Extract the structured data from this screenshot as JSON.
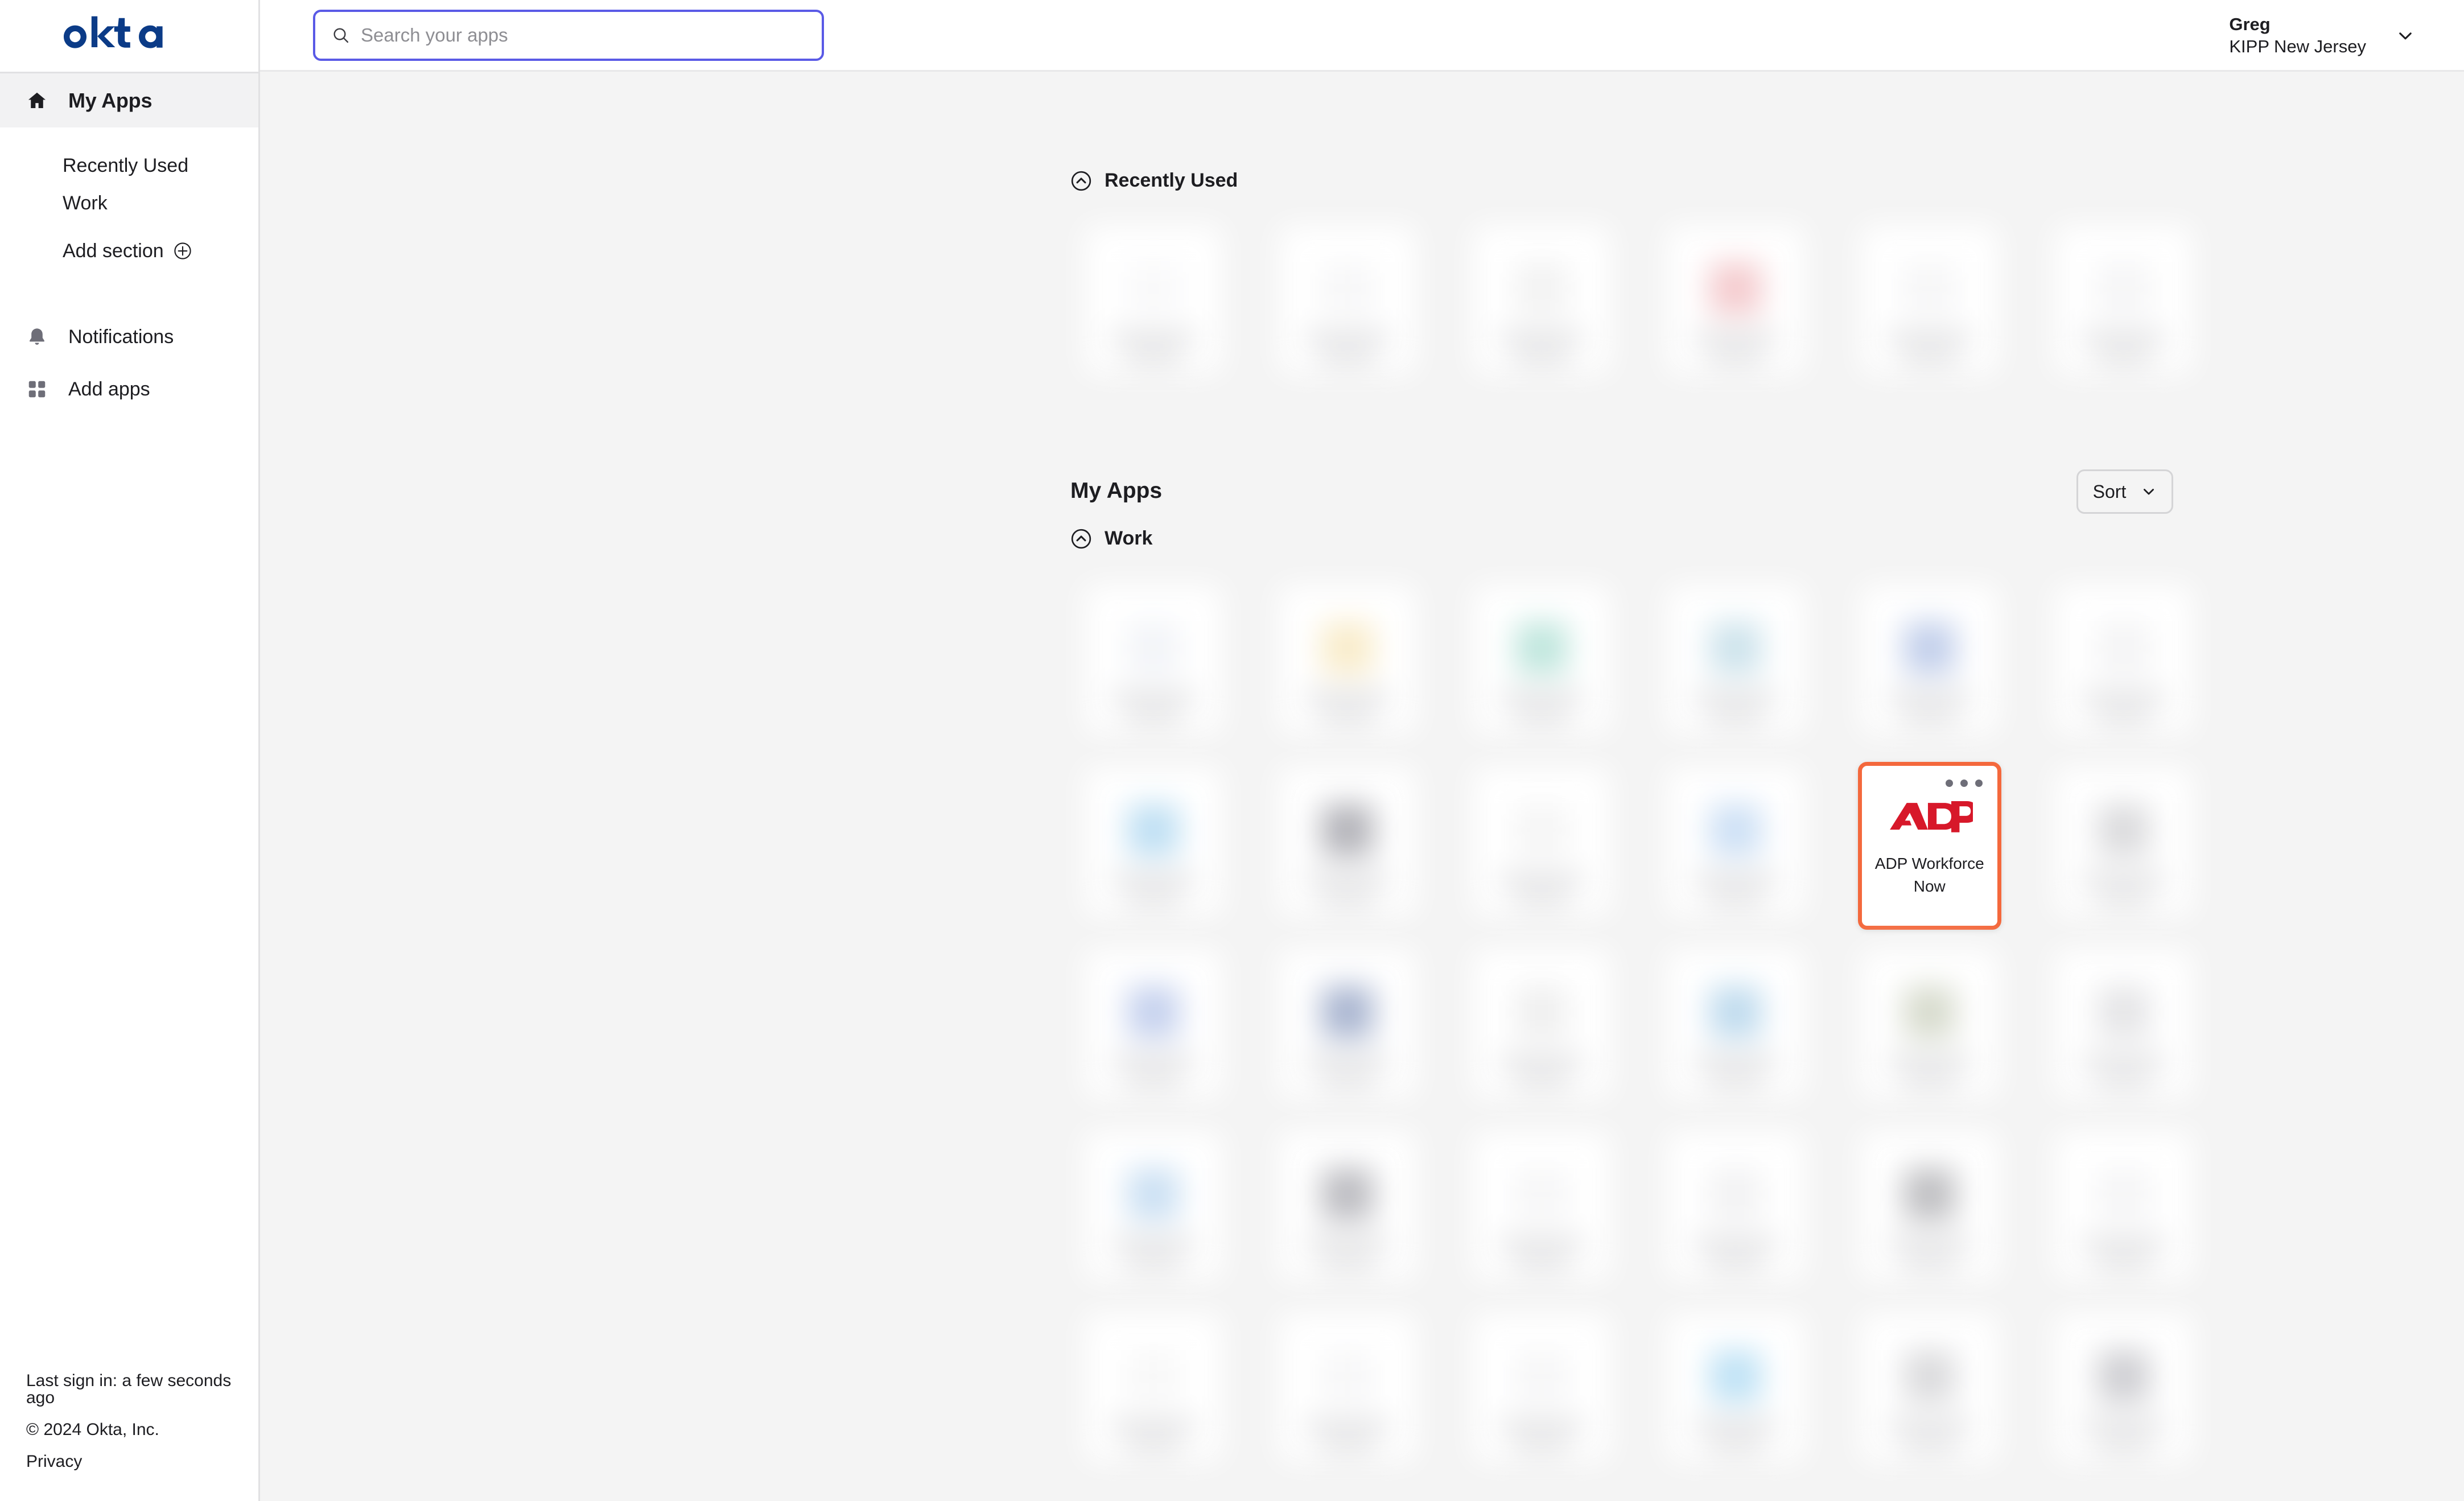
{
  "brand": {
    "logo_text": "okta",
    "logo_color": "#0b3b87",
    "accent_focus": "#f4683c",
    "search_focus_border": "#5a5ae6",
    "adp_red": "#d7182a"
  },
  "sidebar": {
    "primary": {
      "label": "My Apps",
      "icon": "home-icon",
      "active": true
    },
    "sub_items": [
      {
        "label": "Recently Used",
        "icon": null
      },
      {
        "label": "Work",
        "icon": null
      },
      {
        "label": "Add section",
        "icon": "plus-circle-icon"
      }
    ],
    "lower_items": [
      {
        "label": "Notifications",
        "icon": "bell-icon"
      },
      {
        "label": "Add apps",
        "icon": "grid-apps-icon"
      }
    ],
    "footer": {
      "last_sign_in": "Last sign in: a few seconds ago",
      "copyright": "© 2024 Okta, Inc.",
      "privacy": "Privacy"
    }
  },
  "topbar": {
    "search": {
      "placeholder": "Search your apps",
      "value": "",
      "icon": "search-icon",
      "focused": true
    },
    "user": {
      "name": "Greg",
      "org": "KIPP New Jersey",
      "chevron": "chevron-down-icon"
    }
  },
  "main": {
    "recently_used": {
      "label": "Recently Used",
      "collapse_icon": "chevron-up-circle-icon",
      "tiles": [
        {
          "blurred": true,
          "tint": "#f7f7f8"
        },
        {
          "blurred": true,
          "tint": "#f4f4f5"
        },
        {
          "blurred": true,
          "tint": "#ededee"
        },
        {
          "blurred": true,
          "tint": "#f0b9bd"
        },
        {
          "blurred": true,
          "tint": "#f3f3f4"
        },
        {
          "blurred": true,
          "tint": "#f2f2f3"
        }
      ]
    },
    "my_apps_title": "My Apps",
    "sort": {
      "label": "Sort",
      "chevron": "chevron-down-icon"
    },
    "work": {
      "label": "Work",
      "collapse_icon": "chevron-up-circle-icon",
      "tiles": [
        {
          "blurred": true,
          "tint": "#eef0f6"
        },
        {
          "blurred": true,
          "tint": "#f7e6b8"
        },
        {
          "blurred": true,
          "tint": "#a9ddd2"
        },
        {
          "blurred": true,
          "tint": "#bcd9e6"
        },
        {
          "blurred": true,
          "tint": "#aebfe4"
        },
        {
          "blurred": true,
          "tint": "#f0f0f1"
        },
        {
          "blurred": true,
          "tint": "#a8d4ef"
        },
        {
          "blurred": true,
          "tint": "#9a9aa2"
        },
        {
          "blurred": true,
          "tint": "#f1f1f2"
        },
        {
          "blurred": true,
          "tint": "#bcd6f2"
        },
        {
          "blurred": false,
          "app_name": "ADP Workforce Now",
          "logo": "adp-logo",
          "focused": true,
          "menu_icon": "ellipsis-icon"
        },
        {
          "blurred": true,
          "tint": "#cfcfd2"
        },
        {
          "blurred": true,
          "tint": "#b2c2e8"
        },
        {
          "blurred": true,
          "tint": "#8c9cc0"
        },
        {
          "blurred": true,
          "tint": "#e9e9ea"
        },
        {
          "blurred": true,
          "tint": "#a9cfe8"
        },
        {
          "blurred": true,
          "tint": "#c9cfbc"
        },
        {
          "blurred": true,
          "tint": "#dcdcdf"
        },
        {
          "blurred": true,
          "tint": "#b9d6ef"
        },
        {
          "blurred": true,
          "tint": "#a6a6ac"
        },
        {
          "blurred": true,
          "tint": "#f3f3f4"
        },
        {
          "blurred": true,
          "tint": "#eeeeef"
        },
        {
          "blurred": true,
          "tint": "#a9a9ae"
        },
        {
          "blurred": true,
          "tint": "#f2f2f3"
        },
        {
          "blurred": true,
          "tint": "#f5f5f6"
        },
        {
          "blurred": true,
          "tint": "#f4f4f5"
        },
        {
          "blurred": true,
          "tint": "#f3f3f4"
        },
        {
          "blurred": true,
          "tint": "#a9d8f2"
        },
        {
          "blurred": true,
          "tint": "#cfcfd2"
        },
        {
          "blurred": true,
          "tint": "#bfbfc4"
        }
      ]
    }
  }
}
